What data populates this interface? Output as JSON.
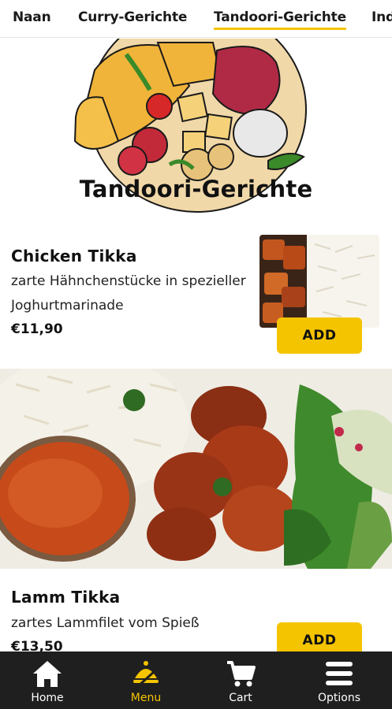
{
  "tabs": [
    {
      "label": "Naan",
      "active": false
    },
    {
      "label": "Curry-Gerichte",
      "active": false
    },
    {
      "label": "Tandoori-Gerichte",
      "active": true
    },
    {
      "label": "Ind",
      "active": false
    }
  ],
  "banner": {
    "title": "Tandoori-Gerichte"
  },
  "items": [
    {
      "name": "Chicken Tikka",
      "description": "zarte Hähnchenstücke in spezieller Joghurtmarinade",
      "price": "€11,90",
      "button": "ADD"
    },
    {
      "name": "Lamm Tikka",
      "description": "zartes Lammfilet vom Spieß",
      "price": "€13,50",
      "button": "ADD"
    }
  ],
  "nav": [
    {
      "label": "Home",
      "icon": "home-icon",
      "active": false
    },
    {
      "label": "Menu",
      "icon": "menu-food-icon",
      "active": true
    },
    {
      "label": "Cart",
      "icon": "cart-icon",
      "active": false
    },
    {
      "label": "Options",
      "icon": "hamburger-icon",
      "active": false
    }
  ],
  "colors": {
    "accent": "#f5c400",
    "nav_bg": "#1f1f1f",
    "text": "#111111"
  }
}
